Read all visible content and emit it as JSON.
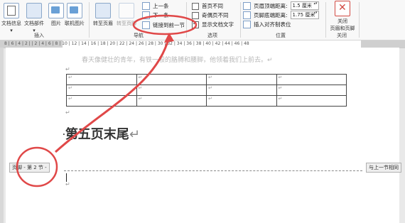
{
  "ribbon": {
    "buttons": [
      {
        "id": "doc-info",
        "label": "文档信息",
        "arrow": "▾"
      },
      {
        "id": "doc-parts",
        "label": "文档部件",
        "arrow": "▾"
      },
      {
        "id": "picture",
        "label": "图片"
      },
      {
        "id": "online-picture",
        "label": "联机图片"
      },
      {
        "id": "goto-header",
        "label": "转至页眉"
      },
      {
        "id": "goto-footer",
        "label": "转至页脚"
      },
      {
        "id": "close",
        "label": "关闭\n页眉和页脚"
      }
    ],
    "close_line1": "关闭",
    "close_line2": "页眉和页脚",
    "nav_prev": "上一条",
    "nav_next": "下一条",
    "link_prev": "链接到前一节",
    "opt_first": "首页不同",
    "opt_oddeven": "奇偶页不同",
    "opt_showtext": "显示文档文字",
    "header_dist_label": "页眉顶端距离:",
    "header_dist_value": "1.5 厘米",
    "footer_dist_label": "页脚底端距离:",
    "footer_dist_value": "1.75 厘米",
    "insert_tab": "插入对齐制表位",
    "groups": {
      "insert": "插入",
      "nav": "导航",
      "options": "选项",
      "position": "位置",
      "close": "关闭"
    }
  },
  "ruler_text": "8 | 6 | 4 | 2 |   | 2 | 4 | 6 | 8 | 10 | 12 | 14 | 16 | 18 | 20 | 22 | 24 | 26 | 28 | 30 | 32 | 34 | 36 | 38 | 40 | 42 | 44 | 46 | 48",
  "document": {
    "faded_line": "春天像健壮的青年，有铁一般的胳膊和腰脚，他领着我们上前去。↵",
    "para_mark": "↵",
    "table_rows": [
      [
        "↵",
        "↵",
        "↵",
        "↵"
      ],
      [
        "↵",
        "↵",
        "↵",
        "↵"
      ],
      [
        "↵",
        "↵",
        "↵",
        "↵"
      ]
    ],
    "heading": "第五页末尾",
    "heading_mark": "↵",
    "footer_label": "页脚 - 第 2 节 -",
    "same_as_prev": "与上一节相同"
  },
  "colors": {
    "annotation": "#e04848",
    "accent": "#2b579a"
  }
}
